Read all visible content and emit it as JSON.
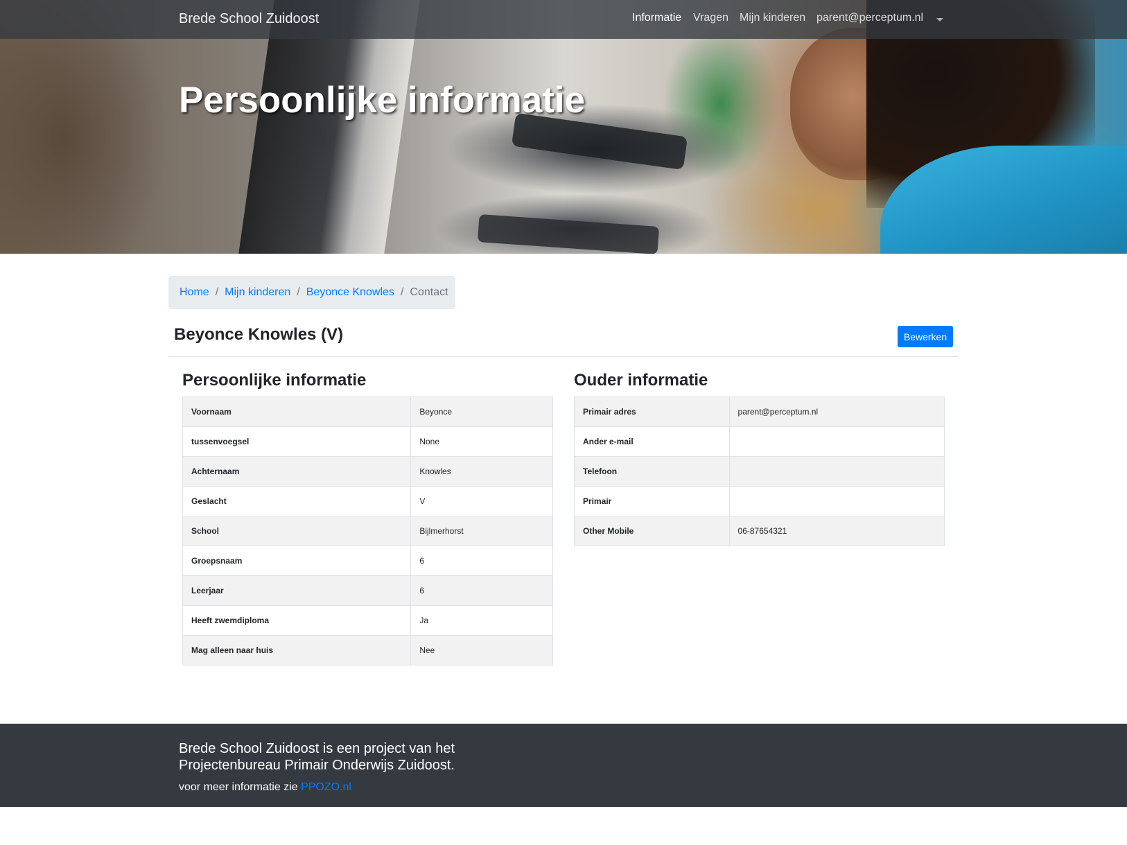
{
  "navbar": {
    "brand": "Brede School Zuidoost",
    "items": [
      {
        "label": "Informatie",
        "active": true
      },
      {
        "label": "Vragen",
        "active": false
      },
      {
        "label": "Mijn kinderen",
        "active": false
      },
      {
        "label": "parent@perceptum.nl",
        "active": false
      }
    ],
    "dropdown_icon": "caret-down-icon"
  },
  "hero": {
    "title": "Persoonlijke informatie"
  },
  "breadcrumb": {
    "items": [
      "Home",
      "Mijn kinderen",
      "Beyonce Knowles"
    ],
    "separator": "/",
    "current": "Contact"
  },
  "child": {
    "heading": "Beyonce Knowles (V)",
    "edit_label": "Bewerken"
  },
  "personal": {
    "title": "Persoonlijke informatie",
    "rows": [
      {
        "label": "Voornaam",
        "value": "Beyonce"
      },
      {
        "label": "tussenvoegsel",
        "value": "None"
      },
      {
        "label": "Achternaam",
        "value": "Knowles"
      },
      {
        "label": "Geslacht",
        "value": "V"
      },
      {
        "label": "School",
        "value": "Bijlmerhorst"
      },
      {
        "label": "Groepsnaam",
        "value": "6"
      },
      {
        "label": "Leerjaar",
        "value": "6"
      },
      {
        "label": "Heeft zwemdiploma",
        "value": "Ja"
      },
      {
        "label": "Mag alleen naar huis",
        "value": "Nee"
      }
    ]
  },
  "parent": {
    "title": "Ouder informatie",
    "rows": [
      {
        "label": "Primair adres",
        "value": "parent@perceptum.nl"
      },
      {
        "label": "Ander e-mail",
        "value": ""
      },
      {
        "label": "Telefoon",
        "value": ""
      },
      {
        "label": "Primair",
        "value": ""
      },
      {
        "label": "Other Mobile",
        "value": "06-87654321"
      }
    ]
  },
  "footer": {
    "text": "Brede School Zuidoost is een project van het Projectenbureau Primair Onderwijs Zuidoost.",
    "more_prefix": "voor meer informatie zie ",
    "link_label": "PPOZO.nl"
  },
  "colors": {
    "navbar": "#343a40",
    "accent": "#007bff",
    "footer": "#343a40",
    "breadcrumb_bg": "#e9ecef"
  }
}
